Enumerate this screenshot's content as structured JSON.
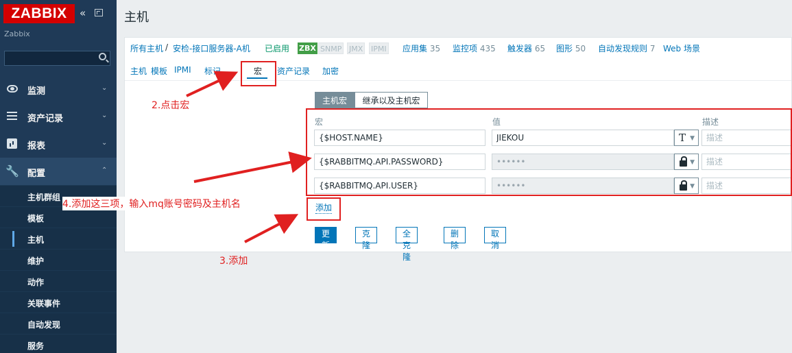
{
  "sidebar": {
    "logo": "ZABBIX",
    "collapse_icon": "«",
    "server_name": "Zabbix",
    "menu": [
      {
        "icon": "eye-icon",
        "label": "监测",
        "chevron": "⌄"
      },
      {
        "icon": "list-icon",
        "label": "资产记录",
        "chevron": "⌄"
      },
      {
        "icon": "chart-icon",
        "label": "报表",
        "chevron": "⌄"
      },
      {
        "icon": "wrench-icon",
        "label": "配置",
        "chevron": "⌃"
      }
    ],
    "submenu": [
      {
        "label": "主机群组"
      },
      {
        "label": "模板"
      },
      {
        "label": "主机",
        "selected": true
      },
      {
        "label": "维护"
      },
      {
        "label": "动作"
      },
      {
        "label": "关联事件"
      },
      {
        "label": "自动发现"
      },
      {
        "label": "服务"
      }
    ]
  },
  "page": {
    "title": "主机"
  },
  "hostnav": {
    "all_hosts": "所有主机",
    "separator": "/",
    "current_host": "安检-接口服务器-A机",
    "status": "已启用",
    "badges": [
      "ZBX",
      "SNMP",
      "JMX",
      "IPMI"
    ],
    "links": [
      {
        "label": "应用集",
        "count": "35"
      },
      {
        "label": "监控项",
        "count": "435"
      },
      {
        "label": "触发器",
        "count": "65"
      },
      {
        "label": "图形",
        "count": "50"
      },
      {
        "label": "自动发现规则",
        "count": "7"
      },
      {
        "label": "Web 场景",
        "count": ""
      }
    ]
  },
  "tabs": [
    "主机",
    "模板",
    "IPMI",
    "标记",
    "宏",
    "资产记录",
    "加密"
  ],
  "active_tab": "宏",
  "macro_toggle": {
    "host_macros": "主机宏",
    "inherited_macros": "继承以及主机宏"
  },
  "table_headers": {
    "macro": "宏",
    "value": "值",
    "description": "描述"
  },
  "macros": [
    {
      "macro": "{$HOST.NAME}",
      "value": "JIEKOU",
      "type": "text",
      "desc_placeholder": "描述"
    },
    {
      "macro": "{$RABBITMQ.API.PASSWORD}",
      "value": "••••••",
      "type": "secret",
      "desc_placeholder": "描述"
    },
    {
      "macro": "{$RABBITMQ.API.USER}",
      "value": "••••••",
      "type": "secret",
      "desc_placeholder": "描述"
    }
  ],
  "add_link": "添加",
  "buttons": {
    "update": "更新",
    "clone": "克隆",
    "full_clone": "全克隆",
    "delete": "删除",
    "cancel": "取消"
  },
  "annotations": {
    "step2": "2.点击宏",
    "step3": "3.添加",
    "step4": "4.添加这三项，输入mq账号密码及主机名",
    "color": "#e02020"
  }
}
